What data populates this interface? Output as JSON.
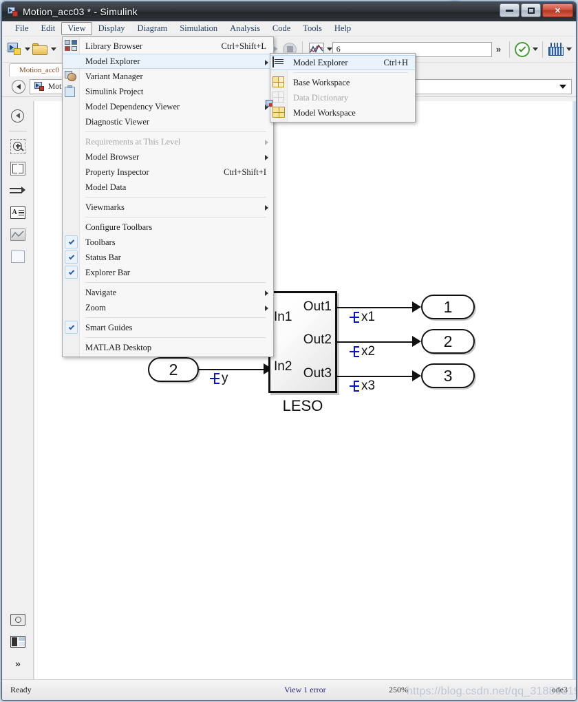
{
  "window": {
    "title": "Motion_acc03 * - Simulink",
    "title_icon": "simulink-model-icon",
    "buttons": {
      "minimize": "minimize-icon",
      "maximize": "maximize-icon",
      "close": "close-icon"
    }
  },
  "menubar": {
    "items": [
      {
        "label": "File",
        "active": false
      },
      {
        "label": "Edit",
        "active": false
      },
      {
        "label": "View",
        "active": true
      },
      {
        "label": "Display",
        "active": false
      },
      {
        "label": "Diagram",
        "active": false
      },
      {
        "label": "Simulation",
        "active": false
      },
      {
        "label": "Analysis",
        "active": false
      },
      {
        "label": "Code",
        "active": false
      },
      {
        "label": "Tools",
        "active": false
      },
      {
        "label": "Help",
        "active": false
      }
    ]
  },
  "toolbar": {
    "sim_time_value": "6",
    "sim_time_placeholder": "",
    "overflow_label": "»",
    "icons": [
      "new-model-icon",
      "open-folder-icon",
      "pause-icon",
      "run-icon",
      "step-forward-icon",
      "stop-icon",
      "scope-icon",
      "check-model-icon",
      "grid-build-icon"
    ]
  },
  "tabs": {
    "items": [
      {
        "label": "Motion_acc0",
        "active": true
      }
    ]
  },
  "explorer_bar": {
    "back_label": "back-icon",
    "breadcrumb": "Moti",
    "dropdown": "chevron-down-icon"
  },
  "view_menu": {
    "items": [
      {
        "label": "Library Browser",
        "accel": "Ctrl+Shift+L",
        "icon": "library-browser-icon",
        "submenu": false,
        "checked": false,
        "disabled": false,
        "hover": false
      },
      {
        "label": "Model Explorer",
        "accel": "",
        "icon": "",
        "submenu": true,
        "checked": false,
        "disabled": false,
        "hover": true
      },
      {
        "label": "Variant Manager",
        "accel": "",
        "icon": "variant-manager-icon",
        "submenu": false,
        "checked": false,
        "disabled": false,
        "hover": false
      },
      {
        "label": "Simulink Project",
        "accel": "",
        "icon": "simulink-project-icon",
        "submenu": false,
        "checked": false,
        "disabled": false,
        "hover": false
      },
      {
        "label": "Model Dependency Viewer",
        "accel": "",
        "icon": "",
        "submenu": true,
        "checked": false,
        "disabled": false,
        "hover": false
      },
      {
        "label": "Diagnostic Viewer",
        "accel": "",
        "icon": "",
        "submenu": false,
        "checked": false,
        "disabled": false,
        "hover": false
      },
      {
        "separator": true
      },
      {
        "label": "Requirements at This Level",
        "accel": "",
        "icon": "",
        "submenu": true,
        "checked": false,
        "disabled": true,
        "hover": false
      },
      {
        "label": "Model Browser",
        "accel": "",
        "icon": "",
        "submenu": true,
        "checked": false,
        "disabled": false,
        "hover": false
      },
      {
        "label": "Property Inspector",
        "accel": "Ctrl+Shift+I",
        "icon": "",
        "submenu": false,
        "checked": false,
        "disabled": false,
        "hover": false
      },
      {
        "label": "Model Data",
        "accel": "",
        "icon": "",
        "submenu": false,
        "checked": false,
        "disabled": false,
        "hover": false
      },
      {
        "separator": true
      },
      {
        "label": "Viewmarks",
        "accel": "",
        "icon": "",
        "submenu": true,
        "checked": false,
        "disabled": false,
        "hover": false
      },
      {
        "separator": true
      },
      {
        "label": "Configure Toolbars",
        "accel": "",
        "icon": "",
        "submenu": false,
        "checked": false,
        "disabled": false,
        "hover": false
      },
      {
        "label": "Toolbars",
        "accel": "",
        "icon": "",
        "submenu": false,
        "checked": true,
        "disabled": false,
        "hover": false
      },
      {
        "label": "Status Bar",
        "accel": "",
        "icon": "",
        "submenu": false,
        "checked": true,
        "disabled": false,
        "hover": false
      },
      {
        "label": "Explorer Bar",
        "accel": "",
        "icon": "",
        "submenu": false,
        "checked": true,
        "disabled": false,
        "hover": false
      },
      {
        "separator": true
      },
      {
        "label": "Navigate",
        "accel": "",
        "icon": "",
        "submenu": true,
        "checked": false,
        "disabled": false,
        "hover": false
      },
      {
        "label": "Zoom",
        "accel": "",
        "icon": "",
        "submenu": true,
        "checked": false,
        "disabled": false,
        "hover": false
      },
      {
        "separator": true
      },
      {
        "label": "Smart Guides",
        "accel": "",
        "icon": "",
        "submenu": false,
        "checked": true,
        "disabled": false,
        "hover": false
      },
      {
        "separator": true
      },
      {
        "label": "MATLAB Desktop",
        "accel": "",
        "icon": "",
        "submenu": false,
        "checked": false,
        "disabled": false,
        "hover": false
      }
    ]
  },
  "model_explorer_submenu": {
    "items": [
      {
        "label": "Model Explorer",
        "accel": "Ctrl+H",
        "icon": "model-explorer-icon",
        "disabled": false,
        "hover": true
      },
      {
        "separator": true
      },
      {
        "label": "Base Workspace",
        "accel": "",
        "icon": "base-workspace-icon",
        "disabled": false,
        "hover": false
      },
      {
        "label": "Data Dictionary",
        "accel": "",
        "icon": "data-dictionary-icon",
        "disabled": true,
        "hover": false
      },
      {
        "label": "Model Workspace",
        "accel": "",
        "icon": "model-workspace-icon",
        "disabled": false,
        "hover": false
      }
    ]
  },
  "sidebar": {
    "items": [
      {
        "icon": "back-navigate-icon"
      },
      {
        "icon": "zoom-in-icon"
      },
      {
        "icon": "fit-to-view-icon"
      },
      {
        "icon": "signal-routing-icon"
      },
      {
        "icon": "annotation-icon"
      },
      {
        "icon": "scope-viewer-icon"
      },
      {
        "icon": "block-square-icon"
      }
    ],
    "bottom_items": [
      {
        "icon": "camera-snapshot-icon"
      },
      {
        "icon": "layout-panel-icon"
      },
      {
        "icon": "expand-more-icon"
      }
    ]
  },
  "diagram": {
    "block_leso": {
      "label": "LESO",
      "inputs": [
        "In1",
        "In2"
      ],
      "outputs": [
        "Out1",
        "Out2",
        "Out3"
      ]
    },
    "input_port": {
      "number": "2",
      "signal": "y"
    },
    "output_ports": [
      {
        "number": "1",
        "signal": "x1"
      },
      {
        "number": "2",
        "signal": "x2"
      },
      {
        "number": "3",
        "signal": "x3"
      }
    ]
  },
  "statusbar": {
    "ready": "Ready",
    "errors": "View 1 error",
    "zoom": "250%",
    "solver": "ode3",
    "watermark": "https://blog.csdn.net/qq_31886319"
  }
}
